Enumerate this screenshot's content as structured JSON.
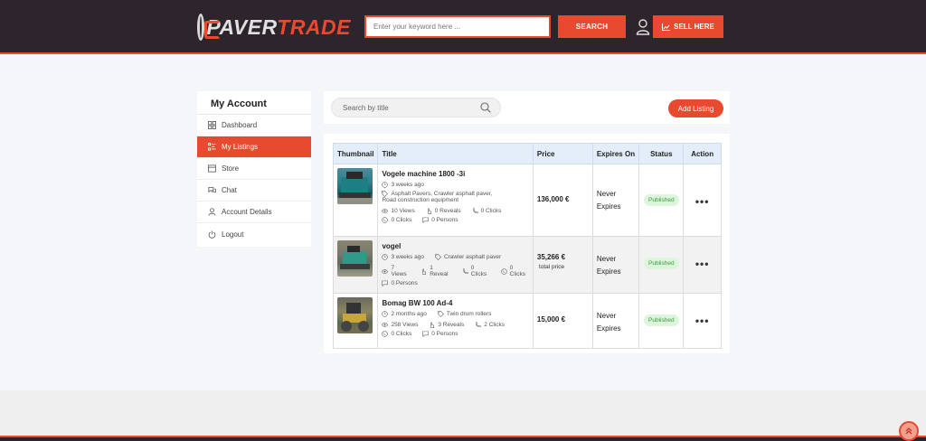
{
  "header": {
    "logo_part1": "PAVER",
    "logo_part2": "TRADE",
    "search_placeholder": "Enter your keyword here ...",
    "search_button": "SEARCH",
    "sell_button": "SELL HERE",
    "accent_color": "#e84a2f",
    "bg_color": "#2e242c"
  },
  "sidebar": {
    "title": "My Account",
    "items": [
      {
        "label": "Dashboard",
        "icon": "grid-icon",
        "active": false
      },
      {
        "label": "My Listings",
        "icon": "list-icon",
        "active": true
      },
      {
        "label": "Store",
        "icon": "store-icon",
        "active": false
      },
      {
        "label": "Chat",
        "icon": "chat-icon",
        "active": false
      },
      {
        "label": "Account Details",
        "icon": "user-icon",
        "active": false
      },
      {
        "label": "Logout",
        "icon": "power-icon",
        "active": false
      }
    ]
  },
  "toolbar": {
    "search_placeholder": "Search by title",
    "add_button": "Add Listing"
  },
  "table": {
    "headers": [
      "Thumbnail",
      "Title",
      "Price",
      "Expires On",
      "Status",
      "Action"
    ],
    "rows": [
      {
        "title": "Vogele machine 1800 -3i",
        "time": "3 weeks ago",
        "tags": "Asphalt Pavers, Crawler asphalt paver,",
        "tags2": "Road construction equipment",
        "views": "10 Views",
        "reveals": "0 Reveals",
        "calls": "0 Clicks",
        "whatsapp": "0 Clicks",
        "persons": "0 Persons",
        "price": "136,000 €",
        "price_sub": "",
        "expires1": "Never",
        "expires2": "Expires",
        "status": "Published",
        "action": "•••"
      },
      {
        "title": "vogel",
        "time": "3 weeks ago",
        "tags": "Crawler asphalt paver",
        "views": "7 Views",
        "reveals": "1 Reveal",
        "calls": "0 Clicks",
        "whatsapp": "0 Clicks",
        "persons": "0 Persons",
        "price": "35,266 €",
        "price_sub": "total price",
        "expires1": "Never",
        "expires2": "Expires",
        "status": "Published",
        "action": "•••"
      },
      {
        "title": "Bomag BW 100 Ad-4",
        "time": "2 months ago",
        "tags": "Twin drum rollers",
        "views": "258 Views",
        "reveals": "3 Reveals",
        "calls": "2 Clicks",
        "whatsapp": "0 Clicks",
        "persons": "0 Persons",
        "price": "15,000 €",
        "price_sub": "",
        "expires1": "Never",
        "expires2": "Expires",
        "status": "Published",
        "action": "•••"
      }
    ]
  }
}
